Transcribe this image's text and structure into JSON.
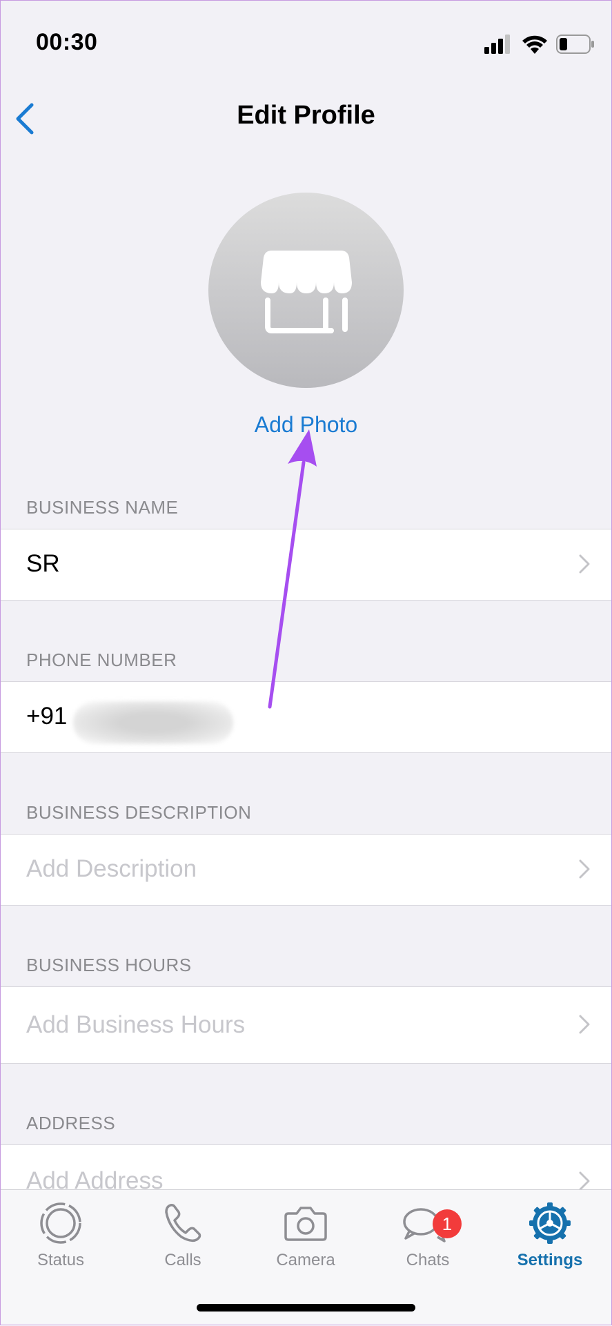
{
  "status_bar": {
    "time": "00:30"
  },
  "nav": {
    "title": "Edit Profile"
  },
  "profile": {
    "add_photo_label": "Add Photo"
  },
  "sections": {
    "business_name": {
      "header": "BUSINESS NAME",
      "value": "SR"
    },
    "phone_number": {
      "header": "PHONE NUMBER",
      "value": "+91"
    },
    "business_description": {
      "header": "BUSINESS DESCRIPTION",
      "placeholder": "Add Description"
    },
    "business_hours": {
      "header": "BUSINESS HOURS",
      "placeholder": "Add Business Hours"
    },
    "address": {
      "header": "ADDRESS",
      "placeholder": "Add Address"
    }
  },
  "tabbar": {
    "tabs": [
      {
        "label": "Status",
        "icon": "status-icon"
      },
      {
        "label": "Calls",
        "icon": "phone-icon"
      },
      {
        "label": "Camera",
        "icon": "camera-icon"
      },
      {
        "label": "Chats",
        "icon": "chats-icon",
        "badge": "1"
      },
      {
        "label": "Settings",
        "icon": "settings-gear-icon",
        "active": true
      }
    ]
  },
  "colors": {
    "accent": "#1a7bd2",
    "active_tab": "#1671ad",
    "badge": "#f23b3b",
    "arrow": "#a64ef0"
  }
}
